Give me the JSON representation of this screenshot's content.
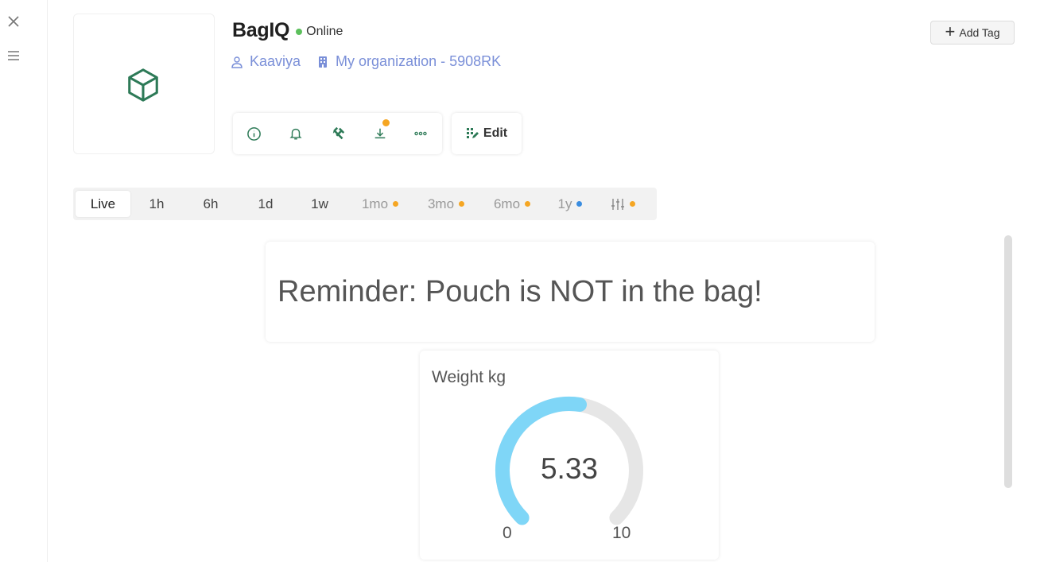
{
  "device": {
    "name": "BagIQ",
    "status": "Online",
    "status_color": "#5cc05c",
    "user": "Kaaviya",
    "organization": "My organization - 5908RK",
    "icon": "cube-icon"
  },
  "header": {
    "add_tag_label": "Add Tag"
  },
  "actions": {
    "items": [
      {
        "name": "info-icon"
      },
      {
        "name": "bell-icon"
      },
      {
        "name": "tools-icon"
      },
      {
        "name": "download-icon",
        "badge": true
      },
      {
        "name": "more-icon"
      }
    ],
    "edit_label": "Edit"
  },
  "time_ranges": [
    {
      "label": "Live",
      "active": true
    },
    {
      "label": "1h"
    },
    {
      "label": "6h"
    },
    {
      "label": "1d"
    },
    {
      "label": "1w"
    },
    {
      "label": "1mo",
      "dot": "#f5a623"
    },
    {
      "label": "3mo",
      "dot": "#f5a623"
    },
    {
      "label": "6mo",
      "dot": "#f5a623"
    },
    {
      "label": "1y",
      "dot": "#3a8de0"
    },
    {
      "label": "",
      "icon": "sliders-icon",
      "dot": "#f5a623"
    }
  ],
  "reminder": {
    "text": "Reminder: Pouch is NOT in the bag!"
  },
  "gauge": {
    "title": "Weight kg",
    "value": 5.33,
    "value_text": "5.33",
    "min": 0,
    "max": 10,
    "min_text": "0",
    "max_text": "10",
    "fill_color": "#7fd6f7",
    "track_color": "#e6e6e6"
  },
  "colors": {
    "accent_green": "#2d7a57",
    "link_blue": "#7a8fd8",
    "badge_orange": "#f5a623"
  }
}
